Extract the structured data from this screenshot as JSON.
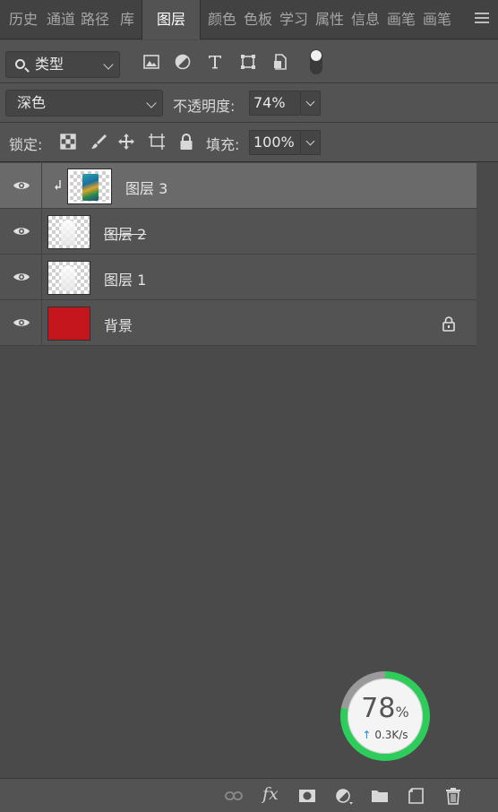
{
  "tabs": [
    "历史",
    "通道",
    "路径",
    "库",
    "图层",
    "颜色",
    "色板",
    "学习",
    "属性",
    "信息",
    "画笔",
    "画笔"
  ],
  "active_tab_index": 4,
  "filter": {
    "kind_label": "类型"
  },
  "blend": {
    "mode": "深色",
    "opacity_label": "不透明度:",
    "opacity_value": "74%"
  },
  "lock": {
    "label": "锁定:",
    "fill_label": "填充:",
    "fill_value": "100%"
  },
  "layers": [
    {
      "name": "图层 3",
      "selected": true,
      "clipped": true,
      "strikethrough": false,
      "locked": false,
      "thumb": "artwork"
    },
    {
      "name": "图层 2",
      "selected": false,
      "clipped": false,
      "strikethrough": true,
      "locked": false,
      "thumb": "transparent-bottle"
    },
    {
      "name": "图层 1",
      "selected": false,
      "clipped": false,
      "strikethrough": false,
      "locked": false,
      "thumb": "transparent-bottle"
    },
    {
      "name": "背景",
      "selected": false,
      "clipped": false,
      "strikethrough": false,
      "locked": true,
      "thumb": "solid-red"
    }
  ],
  "network_widget": {
    "percent": "78",
    "percent_sign": "%",
    "percent_value": 78,
    "speed": "0.3K/s"
  },
  "bottom_toolbar": {
    "fx_label": "fx"
  },
  "colors": {
    "panel_bg": "#535353",
    "selected_row": "#6a6a6a",
    "background_layer_fill": "#c4161c",
    "widget_ring": "#2ecc5a"
  }
}
